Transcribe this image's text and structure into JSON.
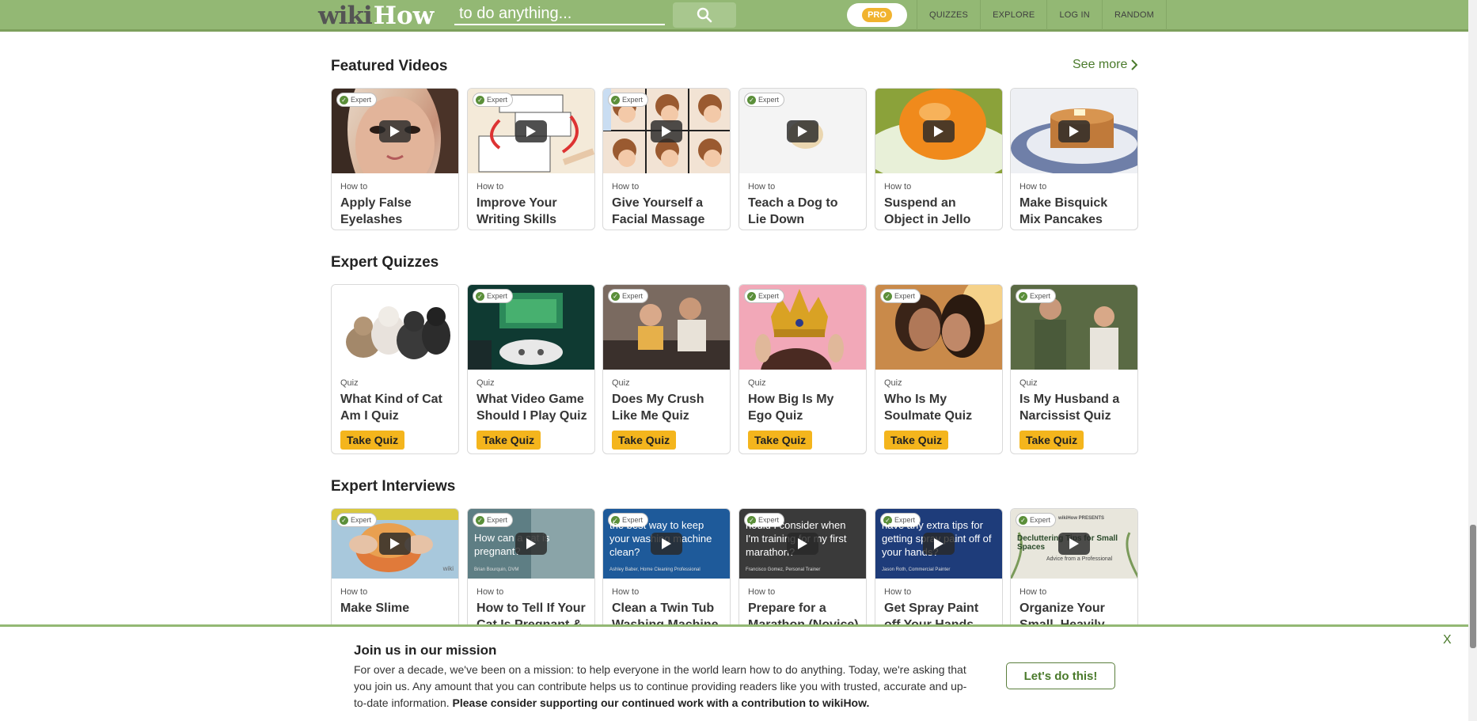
{
  "header": {
    "logo_wiki": "wiki",
    "logo_how": "How",
    "search_placeholder": "to do anything...",
    "pro_label": "PRO",
    "nav": [
      "QUIZZES",
      "EXPLORE",
      "LOG IN",
      "RANDOM"
    ]
  },
  "featured": {
    "title": "Featured Videos",
    "see_more": "See more",
    "cards": [
      {
        "kicker": "How to",
        "title": "Apply False Eyelashes",
        "badge": "Expert"
      },
      {
        "kicker": "How to",
        "title": "Improve Your Writing Skills",
        "badge": "Expert"
      },
      {
        "kicker": "How to",
        "title": "Give Yourself a Facial Massage",
        "badge": "Expert"
      },
      {
        "kicker": "How to",
        "title": "Teach a Dog to Lie Down",
        "badge": "Expert"
      },
      {
        "kicker": "How to",
        "title": "Suspend an Object in Jello",
        "badge": ""
      },
      {
        "kicker": "How to",
        "title": "Make Bisquick Mix Pancakes",
        "badge": ""
      }
    ]
  },
  "quizzes": {
    "title": "Expert Quizzes",
    "button_label": "Take Quiz",
    "cards": [
      {
        "kicker": "Quiz",
        "title": "What Kind of Cat Am I Quiz",
        "badge": ""
      },
      {
        "kicker": "Quiz",
        "title": "What Video Game Should I Play Quiz",
        "badge": "Expert"
      },
      {
        "kicker": "Quiz",
        "title": "Does My Crush Like Me Quiz",
        "badge": "Expert"
      },
      {
        "kicker": "Quiz",
        "title": "How Big Is My Ego Quiz",
        "badge": "Expert"
      },
      {
        "kicker": "Quiz",
        "title": "Who Is My Soulmate Quiz",
        "badge": "Expert"
      },
      {
        "kicker": "Quiz",
        "title": "Is My Husband a Narcissist Quiz",
        "badge": "Expert"
      }
    ]
  },
  "interviews": {
    "title": "Expert Interviews",
    "cards": [
      {
        "kicker": "How to",
        "title": "Make Slime",
        "badge": "Expert",
        "overlay": "",
        "overlay_sub": "wiki"
      },
      {
        "kicker": "How to",
        "title": "How to Tell If Your Cat Is Pregnant & What to Do Next",
        "badge": "Expert",
        "overlay": "How can     a cat is pregnant?",
        "overlay_sub": "Brian Bourquin, DVM"
      },
      {
        "kicker": "How to",
        "title": "Clean a Twin Tub Washing Machine",
        "badge": "Expert",
        "overlay": "the best way to keep your washing machine clean?",
        "overlay_sub": "Ashley Baber, Home Cleaning Professional"
      },
      {
        "kicker": "How to",
        "title": "Prepare for a Marathon (Novice)",
        "badge": "Expert",
        "overlay": "hould I consider when I'm training for my first marathon?",
        "overlay_sub": "Francisco Gomez, Personal Trainer"
      },
      {
        "kicker": "How to",
        "title": "Get Spray Paint off Your Hands",
        "badge": "Expert",
        "overlay": "have any extra tips for getting spray paint off of your hands?",
        "overlay_sub": "Jason Roth, Commercial Painter"
      },
      {
        "kicker": "How to",
        "title": "Organize Your Small, Heavily",
        "badge": "Expert",
        "overlay": "Decluttering Tips for Small Spaces",
        "overlay_sub": "Advice from a Professional",
        "presents": "wikiHow PRESENTS"
      }
    ]
  },
  "banner": {
    "title": "Join us in our mission",
    "text": "For over a decade, we've been on a mission: to help everyone in the world learn how to do anything. Today, we're asking that you join us. Any amount that you can contribute helps us to continue providing readers like you with trusted, accurate and up-to-date information. ",
    "text_bold": "Please consider supporting our continued work with a contribution to wikiHow.",
    "button": "Let's do this!",
    "close": "X"
  },
  "colors": {
    "header_green": "#93b874",
    "accent_green": "#4a7a2b",
    "quiz_yellow": "#f4b51d"
  }
}
